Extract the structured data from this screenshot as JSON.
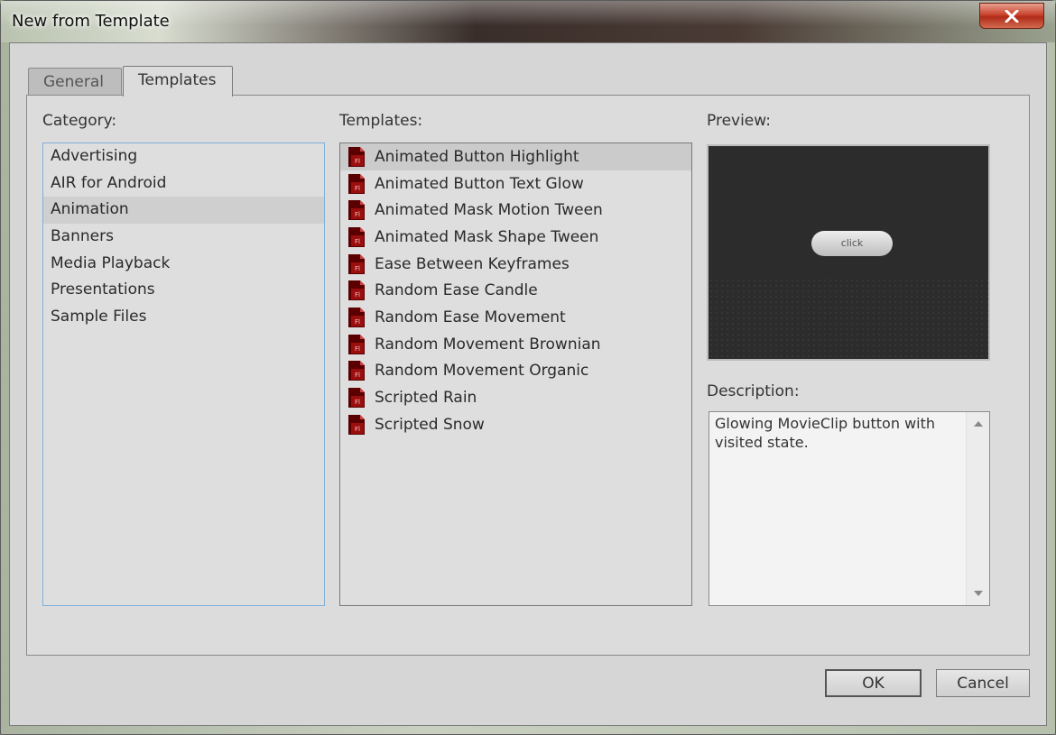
{
  "window": {
    "title": "New from Template"
  },
  "tabs": [
    {
      "label": "General",
      "active": false
    },
    {
      "label": "Templates",
      "active": true
    }
  ],
  "category": {
    "label": "Category:",
    "items": [
      "Advertising",
      "AIR for Android",
      "Animation",
      "Banners",
      "Media Playback",
      "Presentations",
      "Sample Files"
    ],
    "selected": "Animation"
  },
  "templates": {
    "label": "Templates:",
    "items": [
      "Animated Button Highlight",
      "Animated Button Text Glow",
      "Animated Mask Motion Tween",
      "Animated Mask Shape Tween",
      "Ease Between Keyframes",
      "Random Ease Candle",
      "Random Ease Movement",
      "Random Movement Brownian",
      "Random Movement Organic",
      "Scripted Rain",
      "Scripted Snow"
    ],
    "selected": "Animated Button Highlight",
    "icon": "flash-file-icon"
  },
  "preview": {
    "label": "Preview:",
    "button_text": "click"
  },
  "description": {
    "label": "Description:",
    "text": "Glowing MovieClip button with visited state."
  },
  "buttons": {
    "ok": "OK",
    "cancel": "Cancel"
  },
  "colors": {
    "selection": "#cbcbcb",
    "preview_bg": "#2c2c2c",
    "fl_icon": "#8b0000",
    "close_button": "#c9452f"
  }
}
